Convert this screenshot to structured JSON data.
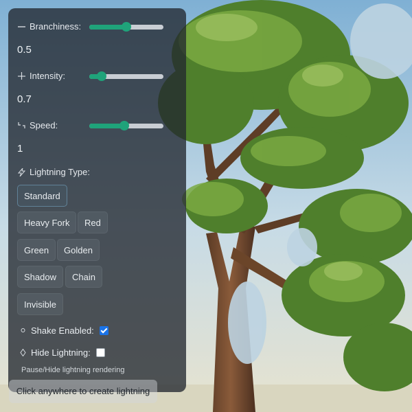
{
  "controls": {
    "branchiness": {
      "label": "Branchiness:",
      "value": "0.5",
      "fraction": 0.5,
      "icon": "horizontal-line-icon"
    },
    "intensity": {
      "label": "Intensity:",
      "value": "0.7",
      "fraction": 0.12,
      "icon": "crosshair-icon"
    },
    "speed": {
      "label": "Speed:",
      "value": "1",
      "fraction": 0.47,
      "icon": "corner-arrows-icon"
    }
  },
  "lightning_type": {
    "label": "Lightning Type:",
    "icon": "lightning-icon",
    "selected": "Standard",
    "options": [
      "Standard",
      "Heavy Fork",
      "Red",
      "Green",
      "Golden",
      "Shadow",
      "Chain",
      "Invisible"
    ]
  },
  "shake": {
    "label": "Shake Enabled:",
    "checked": true,
    "icon": "circle-icon"
  },
  "hide_lightning": {
    "label": "Hide Lightning:",
    "checked": false,
    "icon": "diamond-icon",
    "hint": "Pause/Hide lightning rendering"
  },
  "footer_hint": "Click anywhere to create lightning",
  "colors": {
    "accent": "#1fa37a",
    "checkbox_on": "#1a73e8",
    "panel": "#222830"
  }
}
